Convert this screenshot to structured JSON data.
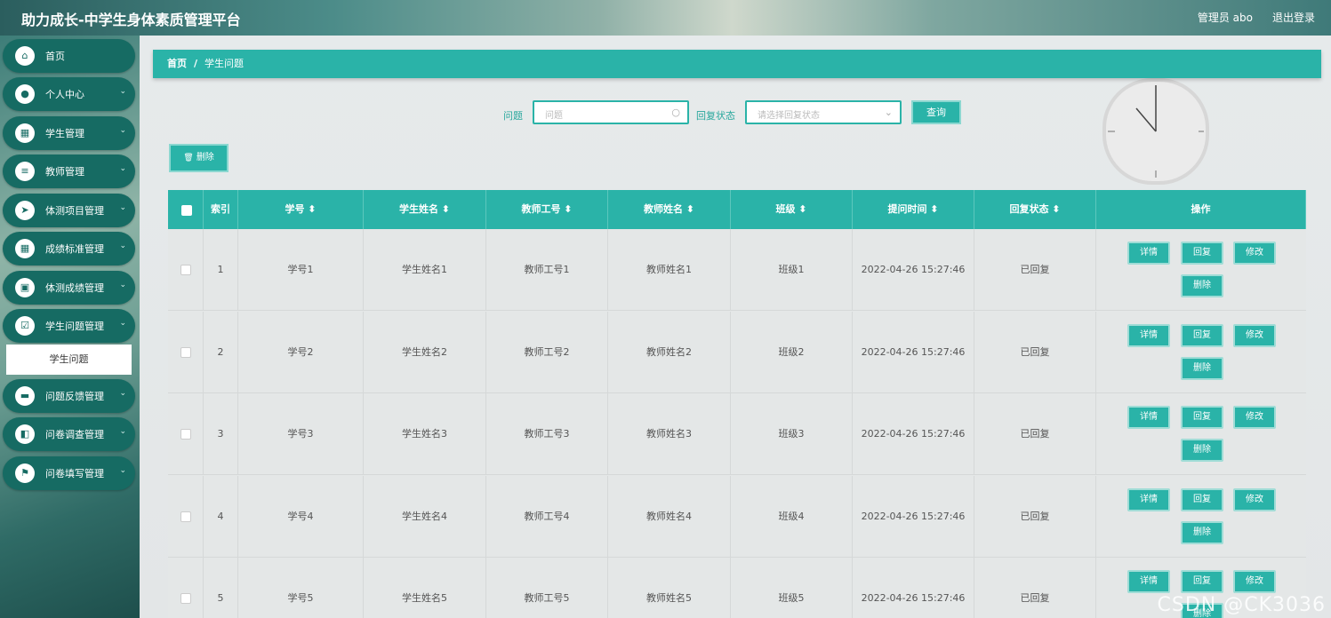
{
  "header": {
    "title": "助力成长-中学生身体素质管理平台",
    "user": "管理员 abo",
    "logout": "退出登录"
  },
  "sidebar": {
    "items": [
      {
        "label": "首页",
        "icon": "home-icon",
        "glyph": "⌂",
        "has_children": false
      },
      {
        "label": "个人中心",
        "icon": "user-icon",
        "glyph": "●",
        "has_children": true
      },
      {
        "label": "学生管理",
        "icon": "grid-icon",
        "glyph": "▦",
        "has_children": true
      },
      {
        "label": "教师管理",
        "icon": "list-icon",
        "glyph": "≡",
        "has_children": true
      },
      {
        "label": "体测项目管理",
        "icon": "send-icon",
        "glyph": "➤",
        "has_children": true
      },
      {
        "label": "成绩标准管理",
        "icon": "grid-icon",
        "glyph": "▦",
        "has_children": true
      },
      {
        "label": "体测成绩管理",
        "icon": "book-icon",
        "glyph": "▣",
        "has_children": true
      },
      {
        "label": "学生问题管理",
        "icon": "clipboard-icon",
        "glyph": "☑",
        "has_children": true
      },
      {
        "label": "问题反馈管理",
        "icon": "monitor-icon",
        "glyph": "▬",
        "has_children": true
      },
      {
        "label": "问卷调查管理",
        "icon": "wallet-icon",
        "glyph": "◧",
        "has_children": true
      },
      {
        "label": "问卷填写管理",
        "icon": "flag-icon",
        "glyph": "⚑",
        "has_children": true
      }
    ],
    "submenu_item": "学生问题"
  },
  "breadcrumb": {
    "home": "首页",
    "sep": "/",
    "current": "学生问题"
  },
  "search": {
    "question_label": "问题",
    "question_placeholder": "问题",
    "status_label": "回复状态",
    "status_placeholder": "请选择回复状态",
    "query_button": "查询"
  },
  "toolbar": {
    "delete_label": "删除",
    "delete_icon": "🗑"
  },
  "table": {
    "headers": [
      "",
      "索引",
      "学号 ⬍",
      "学生姓名 ⬍",
      "教师工号 ⬍",
      "教师姓名 ⬍",
      "班级 ⬍",
      "提问时间 ⬍",
      "回复状态 ⬍",
      "操作"
    ],
    "rows": [
      {
        "index": "1",
        "student_no": "学号1",
        "student_name": "学生姓名1",
        "teacher_no": "教师工号1",
        "teacher_name": "教师姓名1",
        "class": "班级1",
        "time": "2022-04-26 15:27:46",
        "status": "已回复"
      },
      {
        "index": "2",
        "student_no": "学号2",
        "student_name": "学生姓名2",
        "teacher_no": "教师工号2",
        "teacher_name": "教师姓名2",
        "class": "班级2",
        "time": "2022-04-26 15:27:46",
        "status": "已回复"
      },
      {
        "index": "3",
        "student_no": "学号3",
        "student_name": "学生姓名3",
        "teacher_no": "教师工号3",
        "teacher_name": "教师姓名3",
        "class": "班级3",
        "time": "2022-04-26 15:27:46",
        "status": "已回复"
      },
      {
        "index": "4",
        "student_no": "学号4",
        "student_name": "学生姓名4",
        "teacher_no": "教师工号4",
        "teacher_name": "教师姓名4",
        "class": "班级4",
        "time": "2022-04-26 15:27:46",
        "status": "已回复"
      },
      {
        "index": "5",
        "student_no": "学号5",
        "student_name": "学生姓名5",
        "teacher_no": "教师工号5",
        "teacher_name": "教师姓名5",
        "class": "班级5",
        "time": "2022-04-26 15:27:46",
        "status": "已回复"
      }
    ],
    "actions": {
      "detail": "详情",
      "reply": "回复",
      "edit": "修改",
      "delete": "删除"
    }
  },
  "watermark": "CSDN @CK3036",
  "colors": {
    "accent": "#2ab3a8",
    "menu": "#166b63"
  }
}
